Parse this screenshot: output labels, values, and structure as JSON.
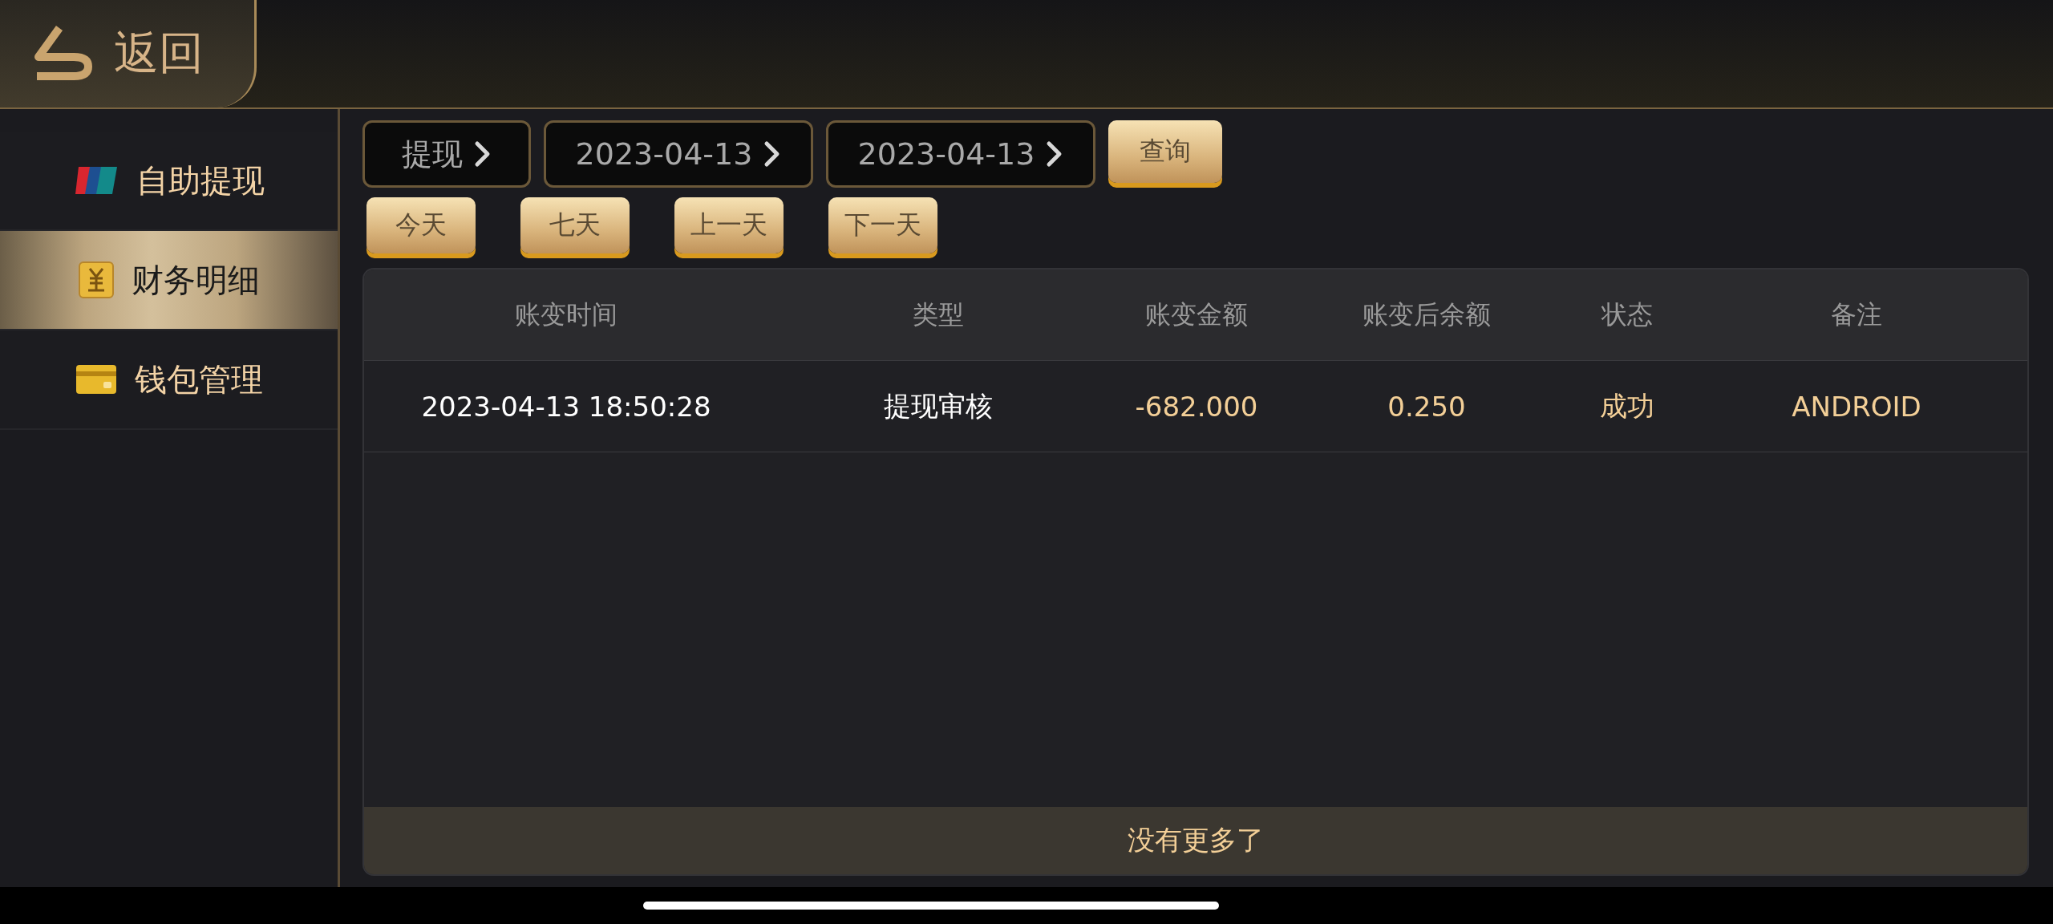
{
  "back_button": {
    "label": "返回"
  },
  "sidebar": {
    "items": [
      {
        "label": "自助提现",
        "kind": "bankcard",
        "selected": false
      },
      {
        "label": "财务明细",
        "kind": "yen",
        "selected": true
      },
      {
        "label": "钱包管理",
        "kind": "wallet",
        "selected": false
      }
    ]
  },
  "filters": {
    "selects": [
      {
        "value": "提现"
      },
      {
        "value": "2023-04-13"
      },
      {
        "value": "2023-04-13"
      }
    ],
    "query_button": "查询"
  },
  "quick_buttons": [
    "今天",
    "七天",
    "上一天",
    "下一天"
  ],
  "table": {
    "columns": [
      "账变时间",
      "类型",
      "账变金额",
      "账变后余额",
      "状态",
      "备注"
    ],
    "rows": [
      {
        "cells": [
          "2023-04-13 18:50:28",
          "提现审核",
          "-682.000",
          "0.250",
          "成功",
          "ANDROID"
        ]
      }
    ],
    "footer": "没有更多了"
  }
}
